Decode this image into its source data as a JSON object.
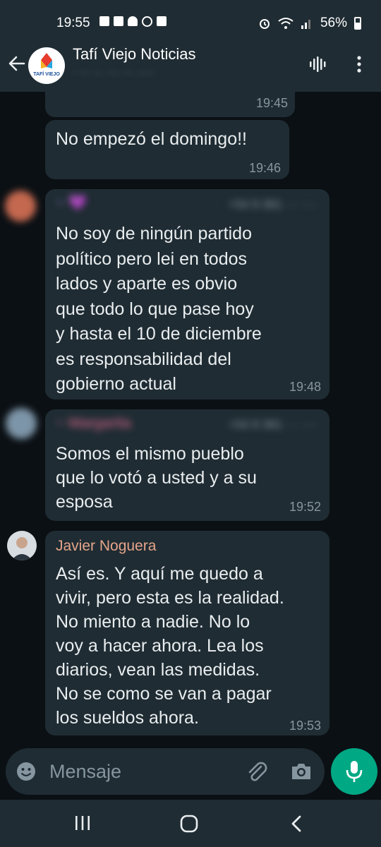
{
  "status": {
    "time": "19:55",
    "battery": "56%"
  },
  "header": {
    "avatar_text": "TAFÍ VIEJO",
    "title": "Tafí Viejo Noticias",
    "subtitle": "· ··· ··· ···· ··· ·····"
  },
  "messages": [
    {
      "text": "",
      "time": "19:45"
    },
    {
      "text": "No empezó el domingo!!",
      "time": "19:46"
    },
    {
      "sender": "~ 💜",
      "phone": "+54 9 381 ··· ····",
      "text": "No soy de ningún partido\npolítico pero lei en todos\nlados y aparte es obvio\nque todo lo que pase hoy\ny hasta el 10 de diciembre\nes responsabilidad del\ngobierno actual",
      "time": "19:48"
    },
    {
      "sender": "~ Margarita",
      "phone": "+54 9 381 ··· ····",
      "text": "Somos el mismo pueblo\nque lo votó a usted y a su\nesposa",
      "time": "19:52"
    },
    {
      "sender": "Javier Noguera",
      "text": "Así es. Y aquí me quedo a\nvivir, pero esta es la realidad.\nNo miento a nadie. No lo\nvoy a hacer ahora. Lea los\ndiarios, vean las medidas.\nNo se como se van a pagar\nlos sueldos ahora.",
      "time": "19:53"
    }
  ],
  "input": {
    "placeholder": "Mensaje"
  },
  "colors": {
    "bubble": "#1f2c33",
    "background": "#0b1014",
    "accent": "#00a884",
    "sender_javier": "#e5a489",
    "sender_margarita": "#e06a8f"
  },
  "icons": [
    "back-arrow-icon",
    "voice-chat-icon",
    "more-options-icon",
    "emoji-icon",
    "attach-icon",
    "camera-icon",
    "mic-icon",
    "recents-icon",
    "home-icon",
    "back-nav-icon"
  ]
}
